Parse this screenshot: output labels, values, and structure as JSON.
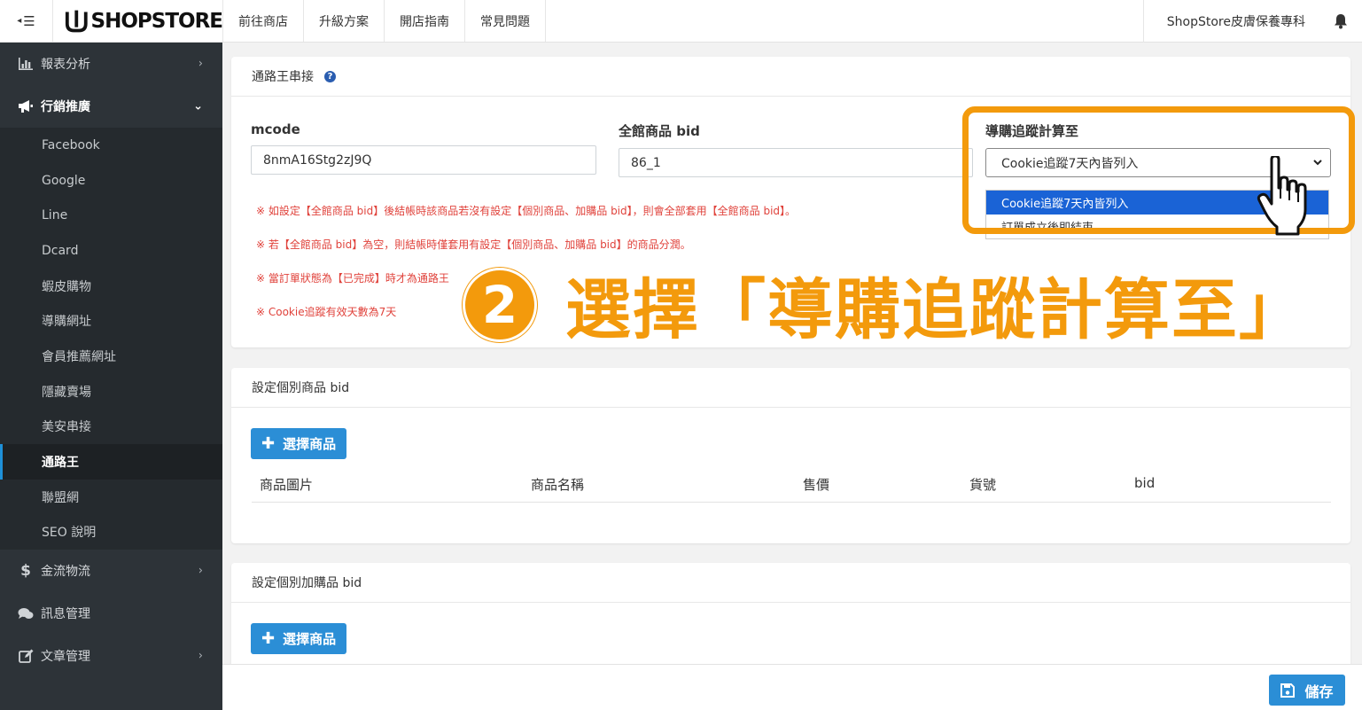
{
  "topbar": {
    "brand": "SHOPSTORE",
    "nav": [
      "前往商店",
      "升級方案",
      "開店指南",
      "常見問題"
    ],
    "store_name": "ShopStore皮膚保養專科"
  },
  "sidebar": {
    "items": [
      {
        "label": "報表分析",
        "icon": "bar-chart-icon"
      },
      {
        "label": "行銷推廣",
        "icon": "megaphone-icon"
      },
      {
        "label": "金流物流",
        "icon": "dollar-icon"
      },
      {
        "label": "訊息管理",
        "icon": "chat-icon"
      },
      {
        "label": "文章管理",
        "icon": "edit-icon"
      }
    ],
    "submenu": [
      "Facebook",
      "Google",
      "Line",
      "Dcard",
      "蝦皮購物",
      "導購網址",
      "會員推薦網址",
      "隱藏賣場",
      "美安串接",
      "通路王",
      "聯盟網",
      "SEO 說明"
    ]
  },
  "card1": {
    "title": "通路王串接",
    "mcode_label": "mcode",
    "mcode_value": "8nmA16Stg2zJ9Q",
    "bid_label": "全館商品 bid",
    "bid_value": "86_1",
    "track_label": "導購追蹤計算至",
    "track_selected": "Cookie追蹤7天內皆列入",
    "track_options": [
      "Cookie追蹤7天內皆列入",
      "訂單成立後即結束"
    ],
    "notes": [
      "※ 如設定【全館商品 bid】後結帳時該商品若沒有設定【個別商品、加購品 bid】，則會全部套用【全館商品 bid】。",
      "※ 若【全館商品 bid】為空，則結帳時僅套用有設定【個別商品、加購品 bid】的商品分潤。",
      "※ 當訂單狀態為【已完成】時才為通路王",
      "※ Cookie追蹤有效天數為7天"
    ]
  },
  "card2": {
    "title": "設定個別商品 bid",
    "button": "選擇商品",
    "columns": [
      "商品圖片",
      "商品名稱",
      "售價",
      "貨號",
      "bid"
    ]
  },
  "card3": {
    "title": "設定個別加購品 bid",
    "button": "選擇商品"
  },
  "overlay": {
    "step": "2",
    "text": "選擇「導購追蹤計算至」"
  },
  "footer": {
    "save": "儲存"
  },
  "colors": {
    "accent_orange": "#f39a0c",
    "primary_blue": "#2b8ed6",
    "sidebar_bg": "#2d3338",
    "note_red": "#e0423b"
  }
}
